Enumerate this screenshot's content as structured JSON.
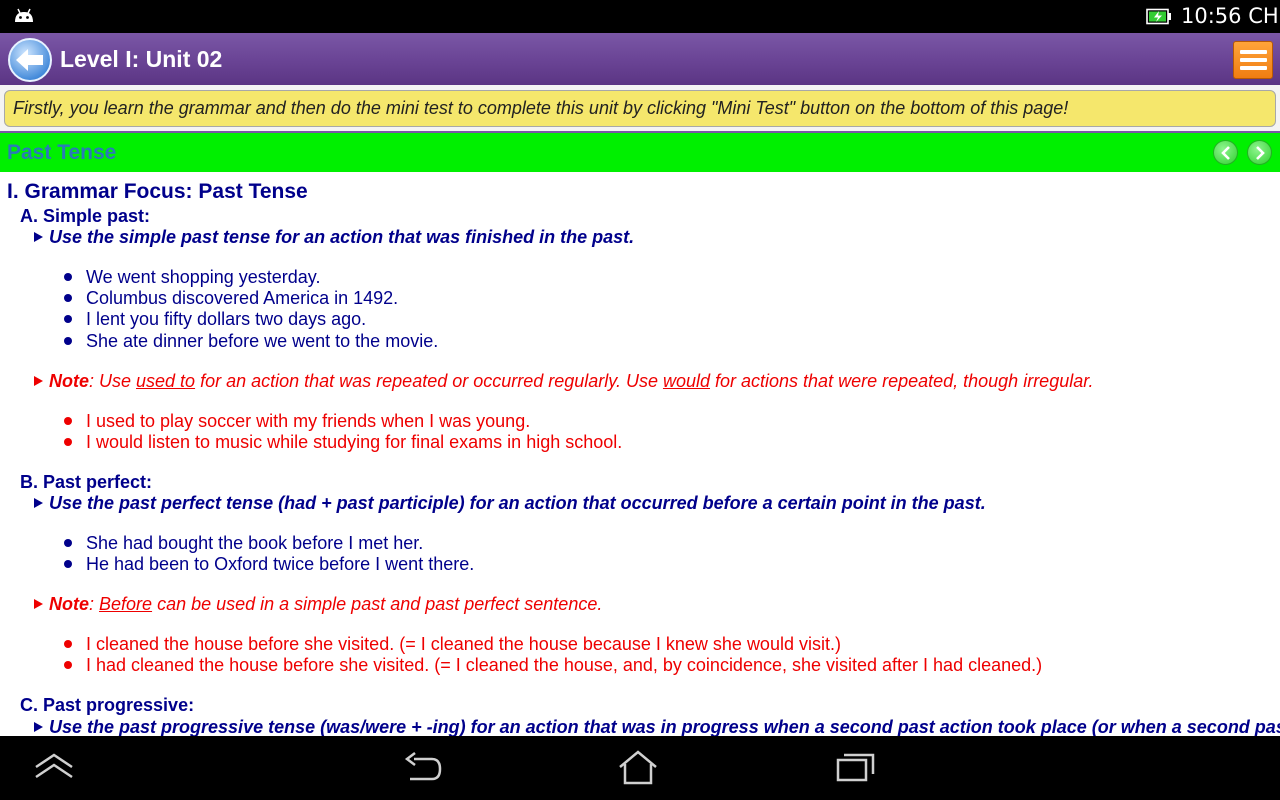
{
  "status_bar": {
    "time": "10:56 CH",
    "icons": [
      "android-debug-icon",
      "battery-charging-icon"
    ]
  },
  "app_bar": {
    "title": "Level I: Unit 02",
    "back_icon": "back-arrow-icon",
    "menu_icon": "menu-icon",
    "colors": {
      "bar": "#6b4596",
      "menu": "#f5891f"
    }
  },
  "notice": "Firstly, you learn the grammar and then do the mini test to complete this unit by clicking \"Mini Test\" button on the bottom of this page!",
  "section": {
    "title": "Past Tense",
    "prev_icon": "chevron-left-icon",
    "next_icon": "chevron-right-icon",
    "color": "#00f000"
  },
  "lesson": {
    "heading": "I. Grammar Focus: Past Tense",
    "a": {
      "title": "A. Simple past:",
      "rule": "Use the simple past tense for an action that was finished in the past.",
      "examples": [
        "We went shopping yesterday.",
        "Columbus discovered America in 1492.",
        "I lent you fifty dollars two days ago.",
        "She ate dinner before we went to the movie."
      ],
      "note": {
        "label": "Note",
        "t1": ": Use ",
        "u1": "used to",
        "t2": " for an action that was repeated or occurred regularly. Use ",
        "u2": "would",
        "t3": " for actions that were repeated, though irregular."
      },
      "note_examples": [
        "I used to play soccer with my friends when I was young.",
        "I would listen to music while studying for final exams in high school."
      ]
    },
    "b": {
      "title": "B. Past perfect:",
      "rule": "Use the past perfect tense (had + past participle) for an action that occurred before a certain point in the past.",
      "examples": [
        "She had bought the book before I met her.",
        "He had been to Oxford twice before I went there."
      ],
      "note": {
        "label": "Note",
        "t1": ": ",
        "u1": "Before",
        "t2": " can be used in a simple past and past perfect sentence."
      },
      "note_examples": [
        "I cleaned the house before she visited. (= I cleaned the house because I knew she would visit.)",
        "I had cleaned the house before she visited. (= I cleaned the house, and, by coincidence, she visited after I had cleaned.)"
      ]
    },
    "c": {
      "title": "C. Past progressive:",
      "rule": "Use the past progressive tense (was/were + -ing) for an action that was in progress when a second past action took place (or when a second past"
    },
    "colors": {
      "main": "#00008b",
      "note": "#ee0000"
    }
  },
  "nav_bar": {
    "icons": [
      "collapse-up-icon",
      "back-icon",
      "home-icon",
      "recent-apps-icon"
    ]
  }
}
